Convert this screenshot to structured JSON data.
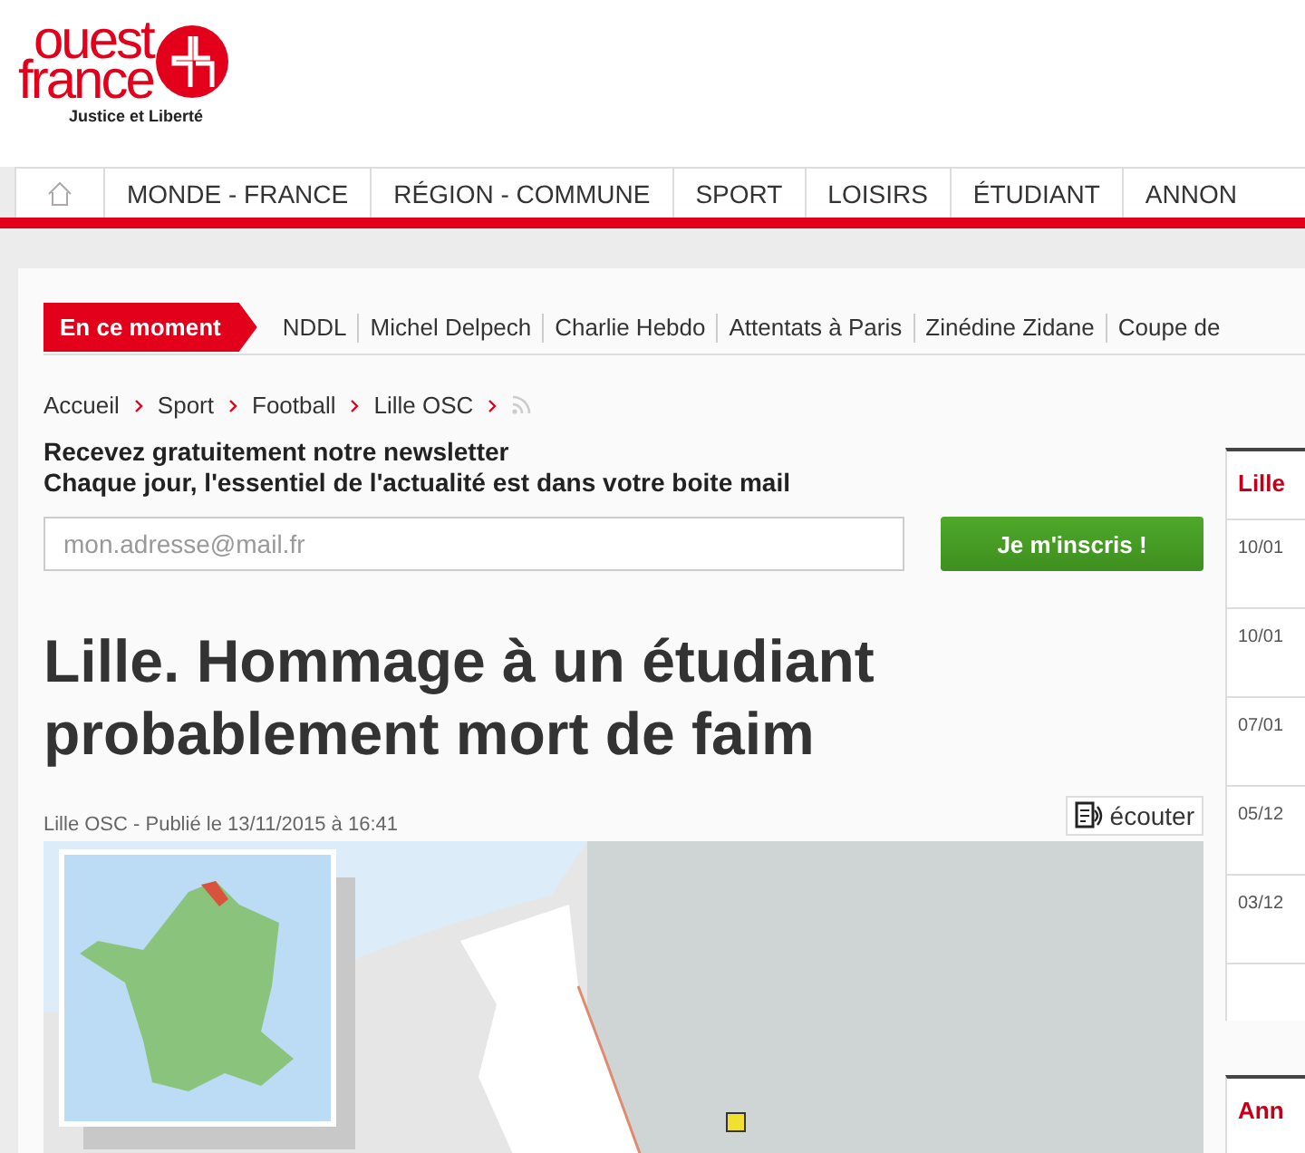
{
  "logo": {
    "line_1": "ouest",
    "line_2": "france",
    "tagline": "Justice et Liberté"
  },
  "nav": {
    "items": [
      {
        "kind": "home",
        "selected": false
      },
      {
        "label": "MONDE - FRANCE",
        "selected": false
      },
      {
        "label": "RÉGION - COMMUNE",
        "selected": false
      },
      {
        "label": "SPORT",
        "selected": false
      },
      {
        "label": "LOISIRS",
        "selected": false
      },
      {
        "label": "ÉTUDIANT",
        "selected": false
      },
      {
        "label": "ANNON",
        "selected": false
      }
    ]
  },
  "trending": {
    "label": "En ce moment",
    "topics": [
      "NDDL",
      "Michel Delpech",
      "Charlie Hebdo",
      "Attentats à Paris",
      "Zinédine Zidane",
      "Coupe de"
    ]
  },
  "breadcrumb": [
    "Accueil",
    "Sport",
    "Football",
    "Lille OSC"
  ],
  "newsletter": {
    "title": "Recevez gratuitement notre newsletter",
    "subtitle": "Chaque jour, l'essentiel de l'actualité est dans votre boite mail",
    "placeholder": "mon.adresse@mail.fr",
    "button": "Je m'inscris !"
  },
  "article": {
    "title": "Lille. Hommage à un étudiant probablement mort de faim",
    "meta": "Lille OSC - Publié le 13/11/2015 à 16:41",
    "listen": "écouter"
  },
  "sidebar": {
    "heading": "Lille",
    "dates": [
      "10/01",
      "10/01",
      "07/01",
      "05/12",
      "03/12"
    ],
    "second_heading": "Ann"
  }
}
